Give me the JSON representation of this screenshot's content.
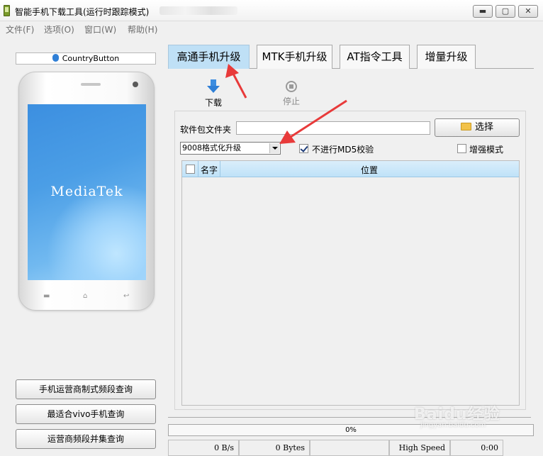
{
  "window": {
    "title": "智能手机下载工具(运行时跟踪模式)",
    "min": "▬",
    "max": "▢",
    "close": "✕"
  },
  "menu": [
    "文件(F)",
    "选项(O)",
    "窗口(W)",
    "帮助(H)"
  ],
  "left": {
    "country_button": "CountryButton",
    "phone_brand": "MediaTek",
    "buttons": [
      "手机运营商制式频段查询",
      "最适合vivo手机查询",
      "运营商频段并集查询"
    ]
  },
  "tabs": [
    "高通手机升级",
    "MTK手机升级",
    "AT指令工具",
    "增量升级"
  ],
  "toolbar": {
    "download": "下载",
    "stop": "停止"
  },
  "form": {
    "folder_label": "软件包文件夹",
    "folder_value": "",
    "select_button": "选择",
    "mode_selected": "9008格式化升级",
    "skip_md5_label": "不进行MD5校验",
    "skip_md5_checked": true,
    "enhanced_label": "增强模式",
    "enhanced_checked": false
  },
  "table": {
    "columns": [
      "名字",
      "位置"
    ],
    "rows": []
  },
  "progress": {
    "percent_text": "0%",
    "value": 0
  },
  "status": {
    "speed": "0 B/s",
    "bytes": "0 Bytes",
    "blank": "",
    "mode": "High Speed",
    "time": "0:00"
  },
  "watermark": {
    "main": "Baidu经验",
    "sub": "jingyan.baidu.com"
  },
  "colors": {
    "tab_active": "#bfe0f6",
    "annotation": "#e83a3a",
    "accent": "#2f7fd6"
  }
}
